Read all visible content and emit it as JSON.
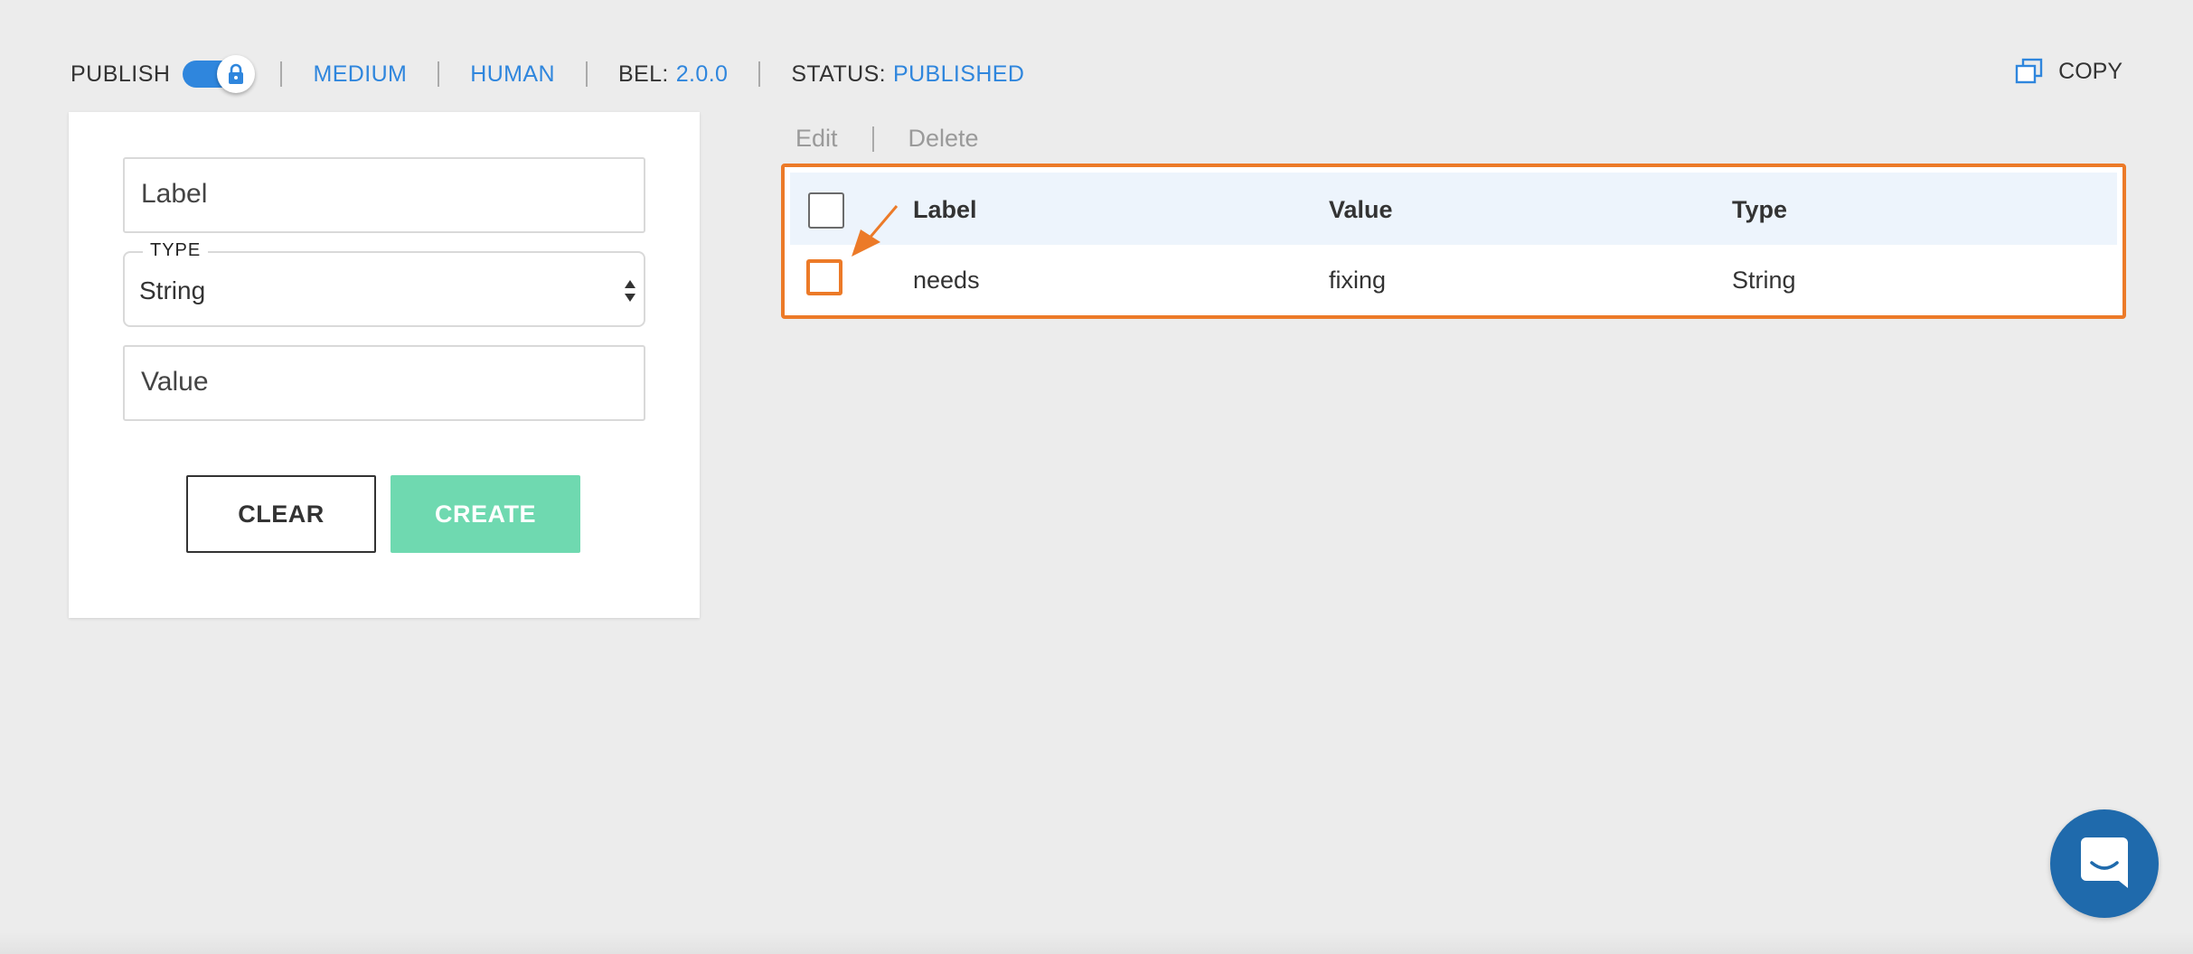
{
  "topbar": {
    "publish_label": "PUBLISH",
    "toggle_on": true,
    "medium_label": "MEDIUM",
    "human_label": "HUMAN",
    "bel_label": "BEL:",
    "bel_version": "2.0.0",
    "status_label": "STATUS:",
    "status_value": "PUBLISHED",
    "copy_label": "COPY"
  },
  "form": {
    "label_placeholder": "Label",
    "type_legend": "TYPE",
    "type_value": "String",
    "value_placeholder": "Value",
    "clear_label": "CLEAR",
    "create_label": "CREATE"
  },
  "table": {
    "actions": {
      "edit": "Edit",
      "delete": "Delete"
    },
    "headers": {
      "label": "Label",
      "value": "Value",
      "type": "Type"
    },
    "rows": [
      {
        "label": "needs",
        "value": "fixing",
        "type": "String"
      }
    ]
  },
  "colors": {
    "accent": "#2f86dd",
    "highlight": "#ec7a28",
    "create": "#6fd9b0",
    "chat": "#1f6aac"
  },
  "icons": [
    "lock-icon",
    "copy-icon",
    "select-arrows-icon",
    "pointer-arrow-icon",
    "chat-icon"
  ]
}
